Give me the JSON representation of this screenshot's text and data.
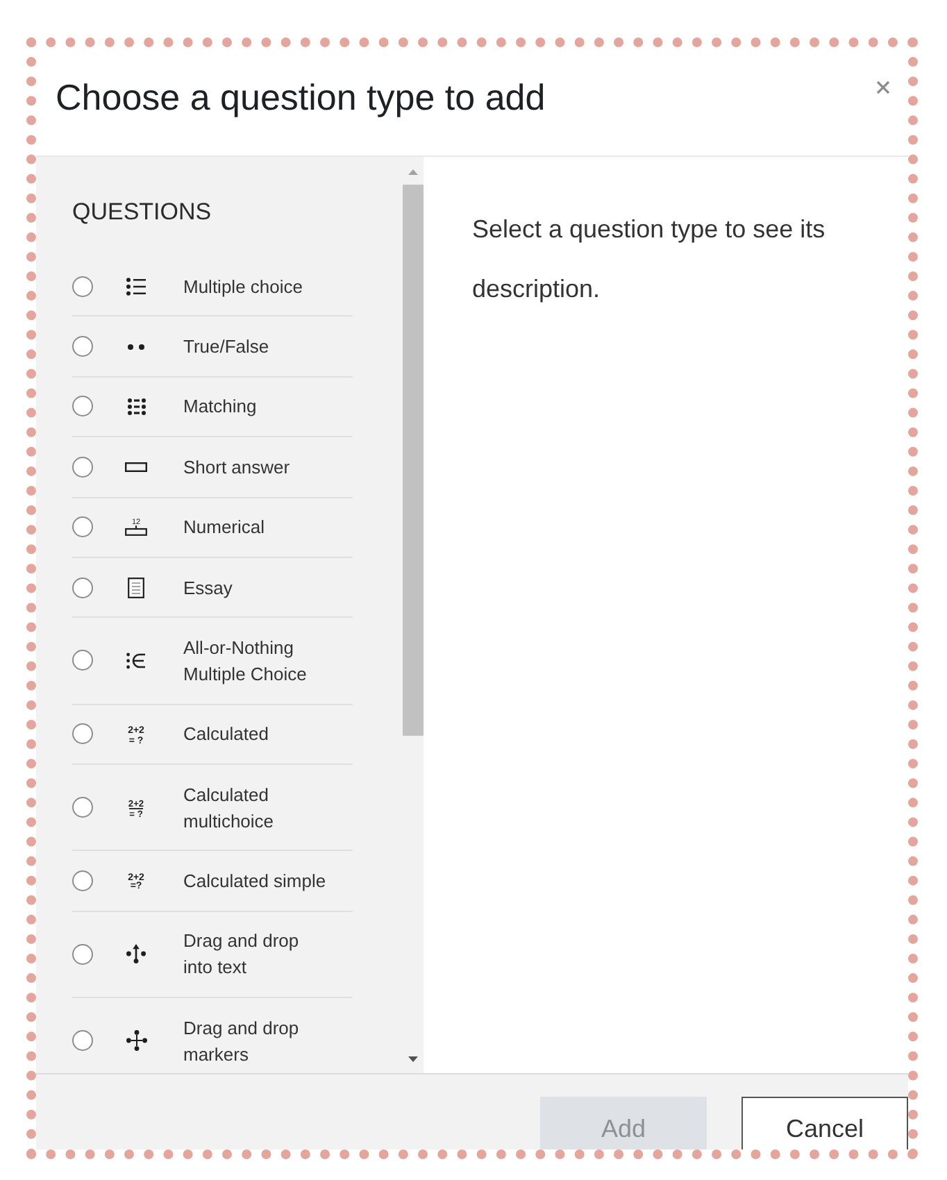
{
  "dialog": {
    "title": "Choose a question type to add"
  },
  "questions": {
    "heading": "QUESTIONS",
    "items": [
      {
        "label": "Multiple choice",
        "kind": "list",
        "selected": false
      },
      {
        "label": "True/False",
        "kind": "pair",
        "selected": false
      },
      {
        "label": "Matching",
        "kind": "grid",
        "selected": false
      },
      {
        "label": "Short answer",
        "kind": "field",
        "selected": false
      },
      {
        "label": "Numerical",
        "kind": "numbered",
        "icon_text": [
          "12"
        ],
        "selected": false
      },
      {
        "label": "Essay",
        "kind": "document",
        "selected": false
      },
      {
        "label": "All-or-Nothing Multiple Choice",
        "kind": "elementof",
        "selected": false
      },
      {
        "label": "Calculated",
        "kind": "formula",
        "icon_text": [
          "2+2",
          "= ?"
        ],
        "selected": false
      },
      {
        "label": "Calculated multichoice",
        "kind": "fraction",
        "icon_text": [
          "2+2",
          "= ?"
        ],
        "selected": false
      },
      {
        "label": "Calculated simple",
        "kind": "stacked",
        "icon_text": [
          "2+2",
          "=?"
        ],
        "selected": false
      },
      {
        "label": "Drag and drop into text",
        "kind": "arrow",
        "selected": false
      },
      {
        "label": "Drag and drop markers",
        "kind": "cross",
        "selected": false
      }
    ]
  },
  "description": {
    "text": "Select a question type to see its description."
  },
  "buttons": [
    {
      "label": "Add",
      "kind": "primary",
      "disabled": true
    },
    {
      "label": "Cancel",
      "kind": "secondary",
      "disabled": false
    }
  ]
}
